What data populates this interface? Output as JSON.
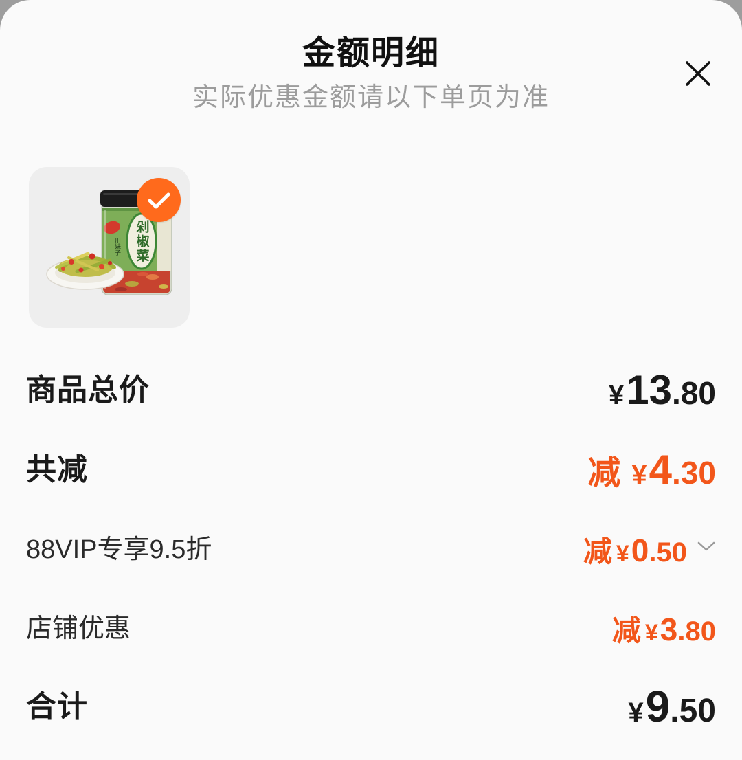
{
  "header": {
    "title": "金额明细",
    "subtitle": "实际优惠金额请以下单页为准",
    "close_icon": "close-icon"
  },
  "product": {
    "selected": true,
    "check_icon": "check-icon",
    "jar_label_text": "剁椒菜",
    "jar_brand_text": "川妹子"
  },
  "summary": {
    "goods_total": {
      "label": "商品总价",
      "currency": "¥",
      "amount": "13.80"
    },
    "total_discount": {
      "label": "共减",
      "prefix": "减",
      "currency": "¥",
      "amount": "4.30"
    },
    "discounts": [
      {
        "label": "88VIP专享9.5折",
        "prefix": "减",
        "currency": "¥",
        "amount": "0.50",
        "expandable": true,
        "expand_icon": "chevron-down-icon"
      },
      {
        "label": "店铺优惠",
        "prefix": "减",
        "currency": "¥",
        "amount": "3.80"
      }
    ],
    "grand_total": {
      "label": "合计",
      "currency": "¥",
      "amount": "9.50"
    }
  },
  "colors": {
    "accent": "#f2561a",
    "check_badge": "#ff6a1c",
    "text_primary": "#1a1a1a",
    "text_secondary": "#9c9c9c",
    "sheet_background": "#fafafa"
  }
}
